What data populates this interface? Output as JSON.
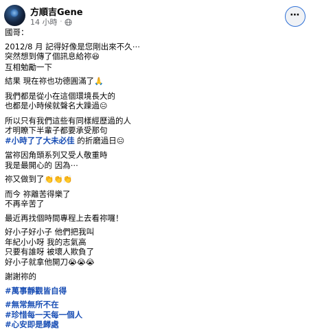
{
  "post": {
    "author": "方順吉Gene",
    "time": "14 小時",
    "more_icon": "⋯",
    "paragraphs": [
      {
        "lines": [
          {
            "text": "國哥："
          }
        ]
      },
      {
        "lines": [
          {
            "text": "2012/8 月 記得好像是您剛出來不久⋯"
          },
          {
            "text": "突然想到傳了個訊息給祢",
            "emoji": "😆"
          },
          {
            "text": "互相勉勵一下"
          }
        ]
      },
      {
        "lines": [
          {
            "text": "結果 現在祢也功德圓滿了",
            "emoji": "🙏"
          }
        ]
      },
      {
        "lines": [
          {
            "text": "我們都是從小在這個環境長大的"
          },
          {
            "text": "也都是小時候就聲名大躁過",
            "emoji": "😑"
          }
        ]
      },
      {
        "lines": [
          {
            "text": "所以只有我們這些有同樣經歷過的人"
          },
          {
            "text": "才明瞭下半輩子都要承受那句"
          },
          {
            "tag": "#小時了了大未必佳",
            "text": " 的折磨過日",
            "emoji": "😑"
          }
        ]
      },
      {
        "lines": [
          {
            "text": "當祢因角頭系列又受人敬重時"
          },
          {
            "text": "我是最開心的 因為⋯"
          }
        ]
      },
      {
        "lines": [
          {
            "text": "祢又做到了",
            "emoji": "👏👏👏"
          }
        ]
      },
      {
        "lines": [
          {
            "text": "而今 祢離苦得樂了"
          },
          {
            "text": "不再辛苦了"
          }
        ]
      },
      {
        "lines": [
          {
            "text": "最近再找個時間專程上去看祢囉！"
          }
        ]
      },
      {
        "lines": [
          {
            "text": "好小子好小子 他們把我叫"
          },
          {
            "text": "年紀小小呀 我的志氣高"
          },
          {
            "text": "只要有誰呀 被壞人欺負了"
          },
          {
            "text": "好小子就拿他開刀",
            "emoji": "😭😭😭"
          }
        ]
      },
      {
        "lines": [
          {
            "text": "謝謝祢的"
          }
        ]
      },
      {
        "lines": [
          {
            "tag": "#萬事靜觀皆自得"
          }
        ]
      },
      {
        "lines": [
          {
            "tag": "#無常無所不在"
          },
          {
            "tag": "#珍惜每一天每一個人"
          },
          {
            "tag": "#心安即是歸處"
          }
        ]
      }
    ]
  },
  "icons": {
    "privacy": "globe-icon",
    "more": "more-options-icon"
  },
  "colors": {
    "hashtag": "#1a4fb5",
    "meta": "#65676b",
    "focus_ring": "#2d6fd6"
  }
}
